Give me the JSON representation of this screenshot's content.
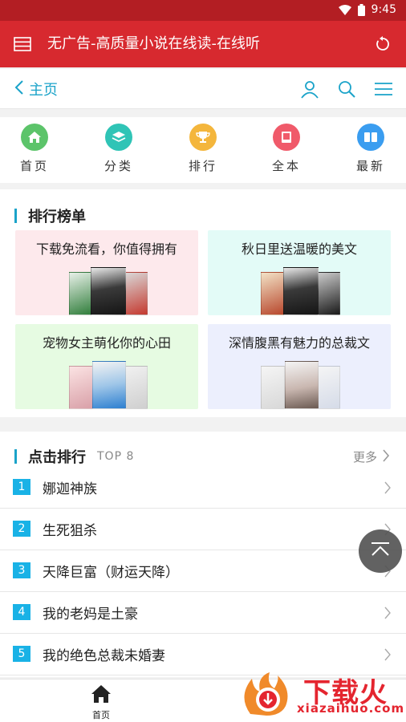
{
  "status_bar": {
    "time": "9:45"
  },
  "app_bar": {
    "title": "无广告-高质量小说在线读-在线听"
  },
  "nav": {
    "back_label": "主页"
  },
  "quick_links": [
    {
      "label": "首页",
      "icon": "home-icon",
      "color": "#5cc46a"
    },
    {
      "label": "分类",
      "icon": "layers-icon",
      "color": "#2fc4b6"
    },
    {
      "label": "排行",
      "icon": "trophy-icon",
      "color": "#f4b63c"
    },
    {
      "label": "全本",
      "icon": "book-icon",
      "color": "#f05a6a"
    },
    {
      "label": "最新",
      "icon": "news-icon",
      "color": "#3a9df0"
    }
  ],
  "rank_section": {
    "title": "排行榜单",
    "tiles": [
      {
        "title": "下载免流看，你值得拥有",
        "bg": "#fde9ec"
      },
      {
        "title": "秋日里送温暖的美文",
        "bg": "#e3fbf7"
      },
      {
        "title": "宠物女主萌化你的心田",
        "bg": "#e6fbe2"
      },
      {
        "title": "深情腹黑有魅力的总裁文",
        "bg": "#eceffd"
      }
    ]
  },
  "click_rank": {
    "title": "点击排行",
    "subtitle": "TOP 8",
    "more_label": "更多",
    "items": [
      {
        "num": "1",
        "name": "娜迦神族"
      },
      {
        "num": "2",
        "name": "生死狙杀"
      },
      {
        "num": "3",
        "name": "天降巨富（财运天降）"
      },
      {
        "num": "4",
        "name": "我的老妈是土豪"
      },
      {
        "num": "5",
        "name": "我的绝色总裁未婚妻"
      }
    ]
  },
  "tab_bar": {
    "home_label": "首页"
  },
  "watermark": {
    "text": "下载火",
    "url": "xiazaihuo.com"
  },
  "colors": {
    "accent": "#1aa3c9",
    "brand": "#d7292f",
    "number_badge": "#19b2e6"
  }
}
